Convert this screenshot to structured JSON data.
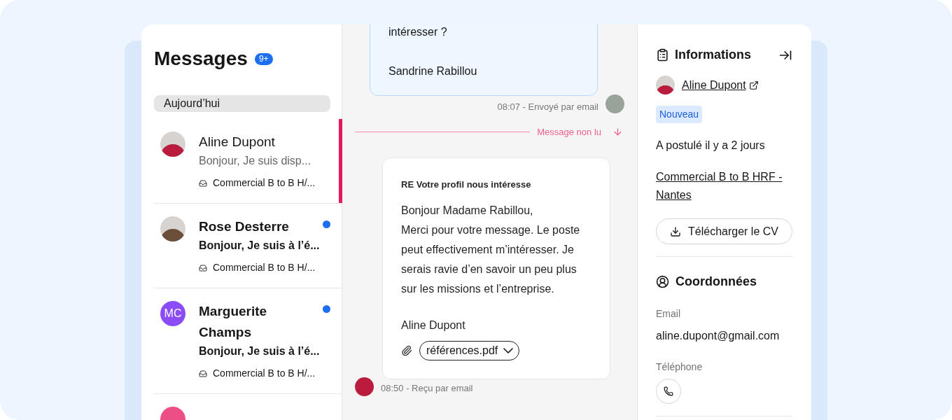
{
  "messages_panel": {
    "title": "Messages",
    "badge": "9+",
    "section": "Aujourd’hui",
    "conversations": [
      {
        "name": "Aline Dupont",
        "preview": "Bonjour, Je suis disp...",
        "job": "Commercial B to B H/...",
        "unread": false,
        "selected": true,
        "avatar": {
          "kind": "photo",
          "color": "#b91c3c"
        }
      },
      {
        "name": "Rose Desterre",
        "preview": "Bonjour, Je suis à l’é...",
        "job": "Commercial B to B H/...",
        "unread": true,
        "selected": false,
        "avatar": {
          "kind": "photo",
          "color": "#6b4f3a"
        }
      },
      {
        "name": "Marguerite Champs",
        "preview": "Bonjour, Je suis à l’é...",
        "job": "Commercial B to B H/...",
        "unread": true,
        "selected": false,
        "avatar": {
          "kind": "initials",
          "initials": "MC",
          "color": "#8b4cf7"
        }
      },
      {
        "avatar": {
          "kind": "blank",
          "color": "#ec4f86"
        }
      }
    ]
  },
  "thread": {
    "sent": {
      "lines": [
        "intéresser ?"
      ],
      "signature": "Sandrine Rabillou",
      "meta": "08:07 - Envoyé par email"
    },
    "unread_divider": "Message non lu",
    "received": {
      "subject": "RE Votre profil nous intéresse",
      "body": [
        "Bonjour Madame Rabillou,",
        "Merci pour votre message. Le poste peut effectivement m’intéresser. Je serais ravie d’en savoir un peu plus sur les missions et l’entreprise."
      ],
      "signature": "Aline Dupont",
      "attachment": "références.pdf",
      "meta": "08:50 - Reçu par email"
    }
  },
  "info_panel": {
    "title": "Informations",
    "candidate": "Aline Dupont",
    "status": "Nouveau",
    "applied": "A postulé il y a 2 jours",
    "job": "Commercial B to B HRF - Nantes",
    "download": "Télécharger le CV",
    "contact": {
      "title": "Coordonnées",
      "fields": [
        {
          "label": "Email",
          "value": "aline.dupont@gmail.com",
          "kind": "text"
        },
        {
          "label": "Téléphone",
          "kind": "phone"
        }
      ]
    }
  }
}
